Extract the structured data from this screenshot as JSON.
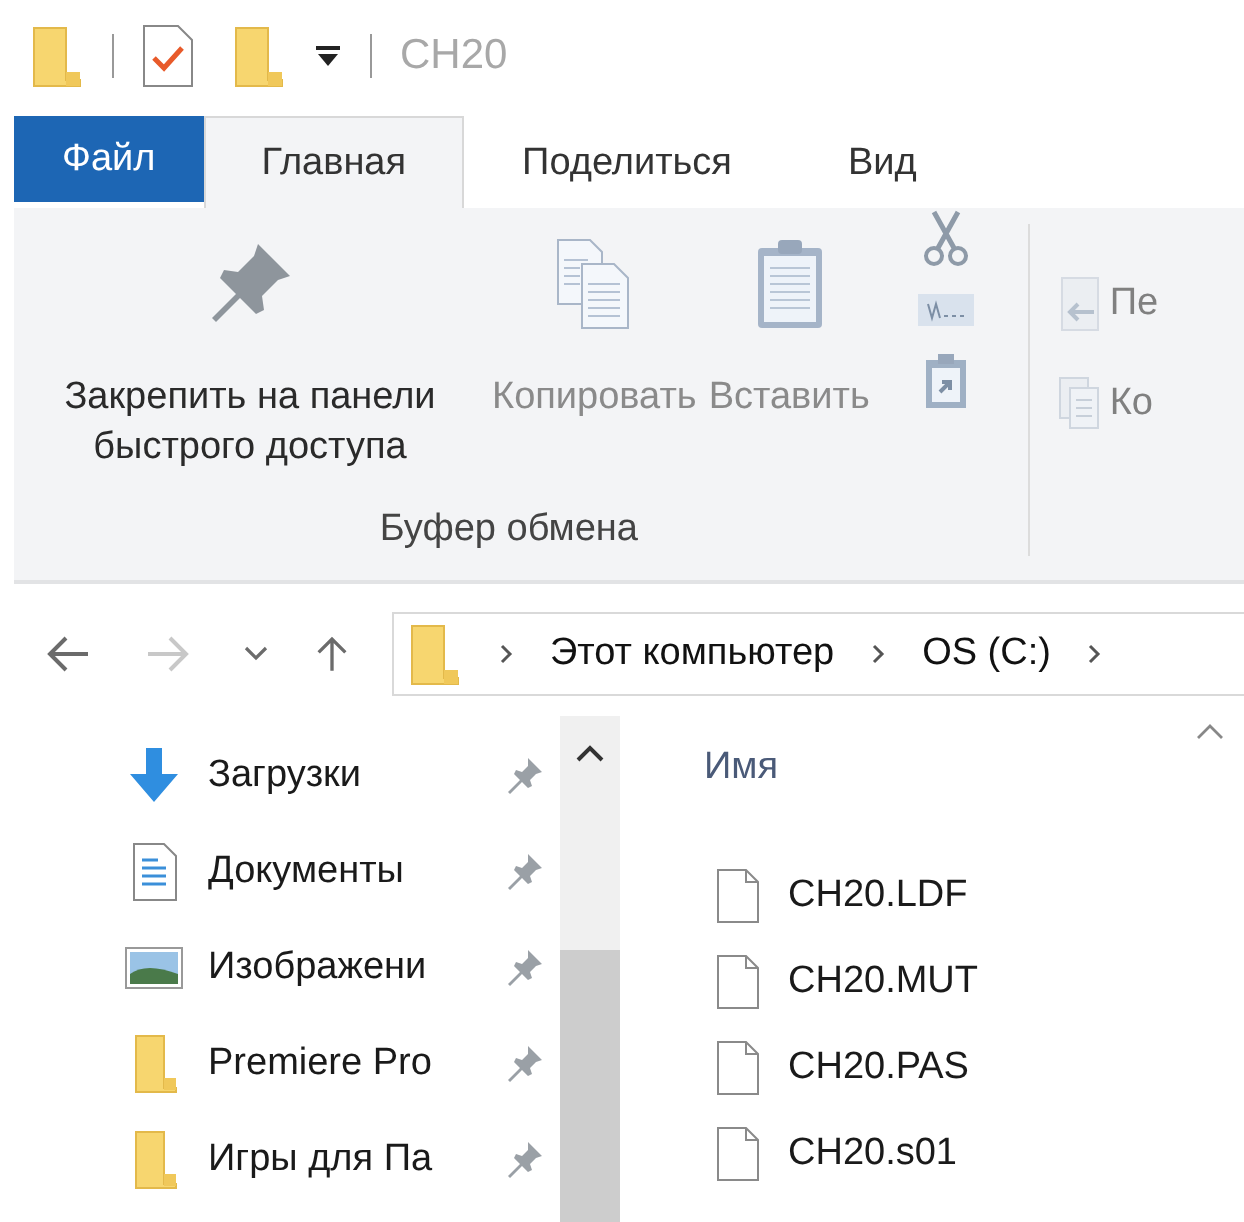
{
  "window": {
    "title": "CH20"
  },
  "tabs": [
    {
      "label": "Файл",
      "kind": "file",
      "selected": false
    },
    {
      "label": "Главная",
      "kind": "tab",
      "selected": true
    },
    {
      "label": "Поделиться",
      "kind": "tab",
      "selected": false
    },
    {
      "label": "Вид",
      "kind": "tab",
      "selected": false
    }
  ],
  "ribbon": {
    "clipboard": {
      "label": "Буфер обмена",
      "large_buttons": [
        {
          "label": "Закрепить на панели быстрого доступа",
          "kind": "pin",
          "disabled": false
        },
        {
          "label": "Копировать",
          "kind": "copy",
          "disabled": true
        },
        {
          "label": "Вставить",
          "kind": "paste",
          "disabled": true
        }
      ],
      "small_buttons": [
        {
          "kind": "cut"
        },
        {
          "kind": "path"
        },
        {
          "kind": "shortcut"
        }
      ]
    },
    "next_group": [
      {
        "label": "Пе",
        "kind": "move",
        "disabled": true
      },
      {
        "label": "Ко",
        "kind": "copyto",
        "disabled": true
      }
    ]
  },
  "navigation": {
    "buttons": [
      {
        "kind": "back",
        "disabled": false
      },
      {
        "kind": "forward",
        "disabled": true
      },
      {
        "kind": "recent",
        "disabled": false
      },
      {
        "kind": "up",
        "disabled": false
      }
    ],
    "address": [
      "Этот компьютер",
      "OS (C:)"
    ]
  },
  "sidebar": {
    "items": [
      {
        "label": "Загрузки",
        "kind": "downloads",
        "pinned": true
      },
      {
        "label": "Документы",
        "kind": "documents",
        "pinned": true
      },
      {
        "label": "Изображени",
        "kind": "pictures",
        "pinned": true
      },
      {
        "label": "Premiere Pro",
        "kind": "folder",
        "pinned": true
      },
      {
        "label": "Игры для Па",
        "kind": "folder",
        "pinned": true
      }
    ]
  },
  "files": {
    "column": "Имя",
    "items": [
      {
        "name": "CH20.LDF"
      },
      {
        "name": "CH20.MUT"
      },
      {
        "name": "CH20.PAS"
      },
      {
        "name": "CH20.s01"
      }
    ]
  }
}
